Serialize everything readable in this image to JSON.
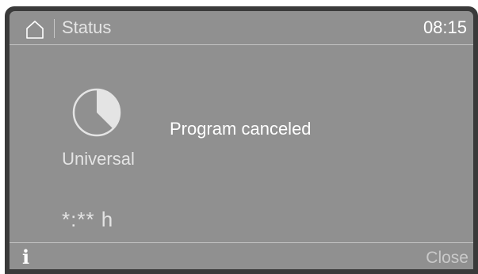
{
  "header": {
    "home_icon": "home-icon",
    "title": "Status",
    "time": "08:15"
  },
  "program": {
    "icon": "universal-program-icon",
    "name": "Universal",
    "remaining_time": "*:** h"
  },
  "status": {
    "message": "Program canceled"
  },
  "footer": {
    "info_icon": "info-icon",
    "info_label": "i",
    "close_label": "Close"
  },
  "colors": {
    "screen_background": "#909090",
    "bezel": "#3a3a3a",
    "text_primary": "#ffffff",
    "text_secondary": "#e4e4e4",
    "text_muted": "#c9c9c9"
  }
}
